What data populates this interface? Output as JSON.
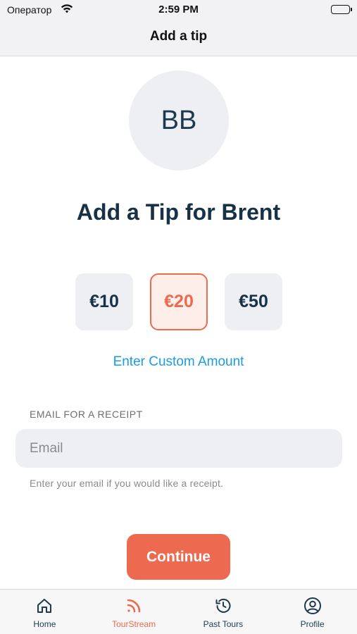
{
  "status_bar": {
    "carrier": "Оператор",
    "time": "2:59 PM"
  },
  "nav": {
    "title": "Add a tip"
  },
  "profile": {
    "initials": "BB"
  },
  "heading": "Add a Tip for Brent",
  "amounts": [
    {
      "label": "€10",
      "selected": false
    },
    {
      "label": "€20",
      "selected": true
    },
    {
      "label": "€50",
      "selected": false
    }
  ],
  "custom_amount_link": "Enter Custom Amount",
  "email": {
    "section_label": "EMAIL FOR A RECEIPT",
    "placeholder": "Email",
    "value": "",
    "hint": "Enter your email if you would like a receipt."
  },
  "continue_label": "Continue",
  "tabs": [
    {
      "label": "Home",
      "icon": "home-icon",
      "active": false
    },
    {
      "label": "TourStream",
      "icon": "rss-icon",
      "active": true
    },
    {
      "label": "Past Tours",
      "icon": "history-icon",
      "active": false
    },
    {
      "label": "Profile",
      "icon": "profile-icon",
      "active": false
    }
  ],
  "colors": {
    "accent": "#ec6a4f",
    "link": "#1a9be6",
    "text_dark": "#173246"
  }
}
